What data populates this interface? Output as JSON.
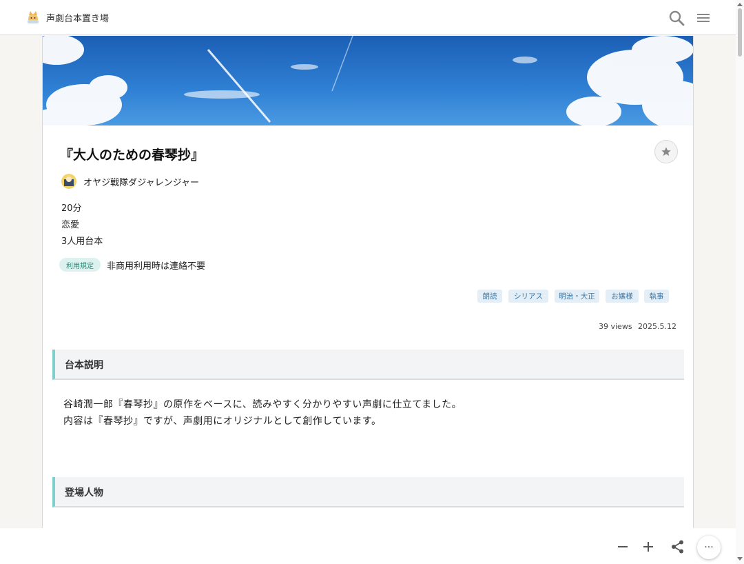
{
  "header": {
    "site_title": "声劇台本置き場"
  },
  "script": {
    "title": "『大人のための春琴抄』",
    "author": "オヤジ戦隊ダジャレンジャー",
    "duration": "20分",
    "genre": "恋愛",
    "cast": "3人用台本",
    "rule_badge": "利用規定",
    "rule_text": "非商用利用時は連絡不要",
    "tags": [
      "朗読",
      "シリアス",
      "明治・大正",
      "お嬢様",
      "執事"
    ],
    "views": "39 views",
    "date": "2025.5.12"
  },
  "sections": {
    "description_title": "台本説明",
    "description_lines": [
      "谷崎潤一郎『春琴抄』の原作をベースに、読みやすく分かりやすい声劇に仕立てました。",
      "内容は『春琴抄』ですが、声劇用にオリジナルとして創作しています。"
    ],
    "characters_title": "登場人物"
  },
  "toolbar": {
    "more_label": "···"
  },
  "colors": {
    "accent": "#7fcfcc",
    "tag_bg": "#e3eef6",
    "tag_text": "#3b78a8",
    "badge_bg": "#ddf2ee"
  }
}
